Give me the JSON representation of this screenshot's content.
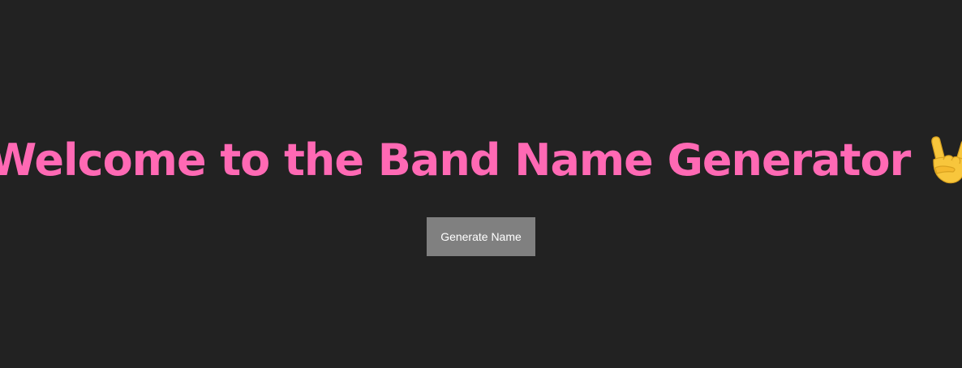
{
  "header": {
    "title": "Welcome to the Band Name Generator",
    "title_icon": "rock-on-hand-icon"
  },
  "main": {
    "generate_button_label": "Generate Name"
  },
  "colors": {
    "background": "#222222",
    "title": "#ff69b4",
    "button_background": "#808080",
    "button_text": "#ffffff",
    "icon_skin": "#f8c63c"
  }
}
